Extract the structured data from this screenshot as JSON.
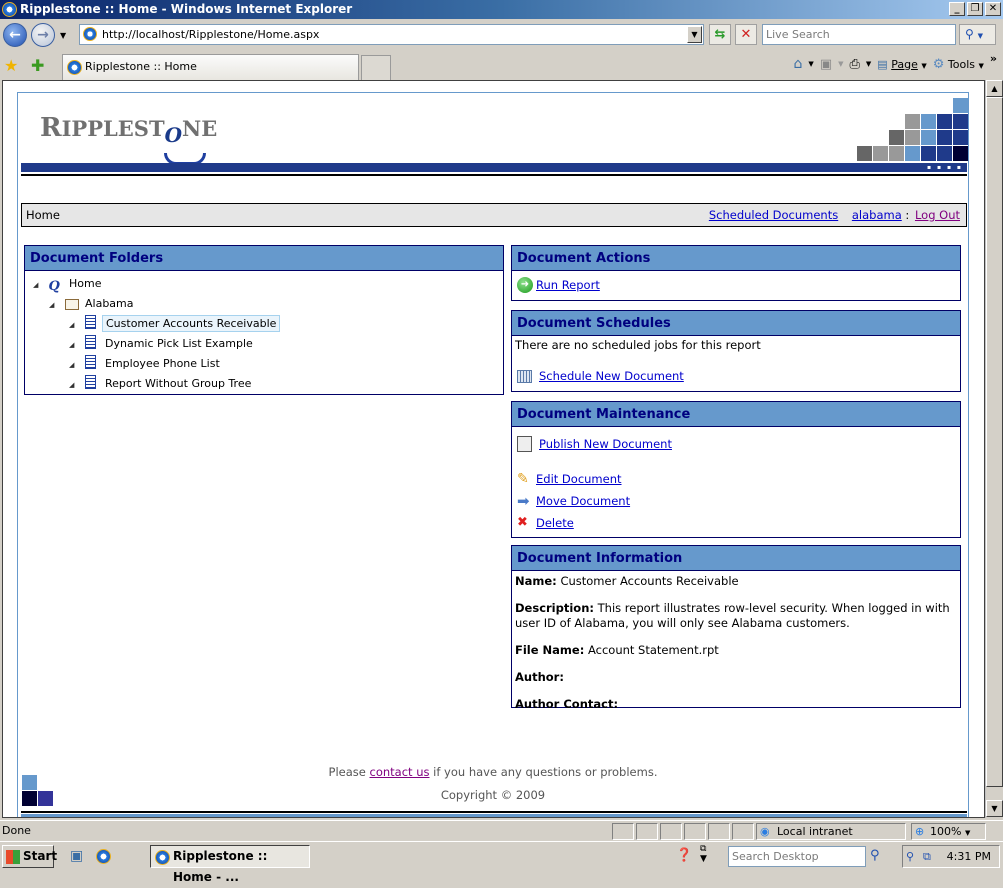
{
  "window": {
    "title": "Ripplestone :: Home - Windows Internet Explorer",
    "controls": [
      "minimize",
      "restore",
      "close"
    ]
  },
  "browser": {
    "address": "http://localhost/Ripplestone/Home.aspx",
    "search_placeholder": "Live Search",
    "tab_title": "Ripplestone :: Home",
    "command_bar": {
      "page_label": "Page",
      "tools_label": "Tools",
      "overflow": "»"
    },
    "status_text": "Done",
    "zone": "Local intranet",
    "zoom": "100%"
  },
  "site": {
    "logo_text": "RIPPLESTONE",
    "logo_parts": {
      "r": "R",
      "ipplest": "IPPLEST",
      "o": "O",
      "ne": "NE"
    },
    "brand_colors": {
      "dark_blue": "#1f3a8a",
      "panel_header": "#6699cc",
      "panel_title": "#000080"
    }
  },
  "navbar": {
    "breadcrumb": "Home",
    "scheduled_documents": "Scheduled Documents",
    "username": "alabama",
    "separator": ":",
    "logout": "Log Out"
  },
  "folders": {
    "title": "Document Folders",
    "root": "Home",
    "folder": "Alabama",
    "documents": [
      {
        "label": "Customer Accounts Receivable",
        "selected": true
      },
      {
        "label": "Dynamic Pick List Example",
        "selected": false
      },
      {
        "label": "Employee Phone List",
        "selected": false
      },
      {
        "label": "Report Without Group Tree",
        "selected": false
      }
    ]
  },
  "actions": {
    "title": "Document Actions",
    "run_report": "Run Report"
  },
  "schedules": {
    "title": "Document Schedules",
    "empty_text": "There are no scheduled jobs for this report",
    "schedule_new": "Schedule New Document"
  },
  "maintenance": {
    "title": "Document Maintenance",
    "publish": "Publish New Document",
    "edit": "Edit Document",
    "move": "Move Document",
    "delete": "Delete"
  },
  "information": {
    "title": "Document Information",
    "name_label": "Name:",
    "name": "Customer Accounts Receivable",
    "description_label": "Description:",
    "description": "This report illustrates row-level security. When logged in with user ID of Alabama, you will only see Alabama customers.",
    "file_label": "File Name:",
    "file": "Account Statement.rpt",
    "author_label": "Author:",
    "author": "",
    "contact_label": "Author Contact:",
    "contact": ""
  },
  "footer": {
    "pre": "Please ",
    "link": "contact us",
    "post": " if you have any questions or problems.",
    "copyright": "Copyright © 2009"
  },
  "taskbar": {
    "start": "Start",
    "task": "Ripplestone :: Home - ...",
    "search_placeholder": "Search Desktop",
    "clock": "4:31 PM"
  }
}
